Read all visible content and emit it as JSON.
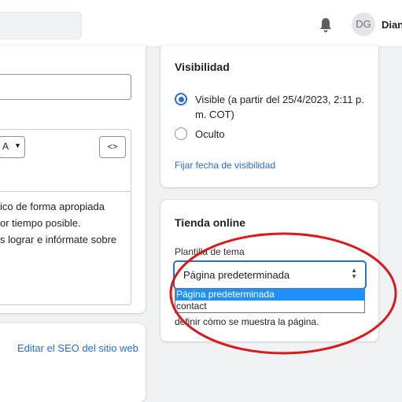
{
  "topbar": {
    "user_initials": "DG",
    "user_name": "Dian"
  },
  "editor": {
    "format_icon_text": "A",
    "code_button_label": "<>",
    "body_lines": [
      "ico de forma apropiada",
      "or tiempo posible.",
      "s lograr e infórmate sobre"
    ]
  },
  "seo": {
    "link_label": "Editar el SEO del sitio web"
  },
  "visibility": {
    "title": "Visibilidad",
    "option_visible": "Visible (a partir del 25/4/2023, 2:11 p. m. COT)",
    "option_hidden": "Oculto",
    "set_date_link": "Fijar fecha de visibilidad",
    "selected": "visible"
  },
  "online_store": {
    "title": "Tienda online",
    "template_label": "Plantilla de tema",
    "selected_value": "Página predeterminada",
    "options": [
      "Página predeterminada",
      "contact"
    ],
    "help_text": "definir cómo se muestra la página."
  },
  "colors": {
    "accent": "#2c6ecb",
    "annotation": "#d9191c",
    "option_highlight": "#1e90ff"
  },
  "icons": {
    "bell": "bell-icon",
    "select_arrows": "select-arrows-icon"
  }
}
